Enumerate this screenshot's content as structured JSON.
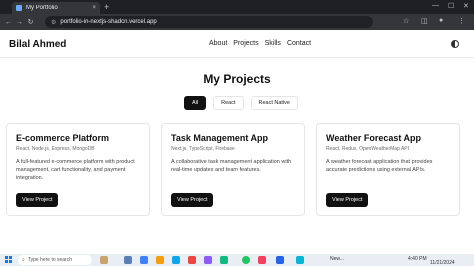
{
  "browser": {
    "tab_title": "My Portfolio",
    "tab_close": "×",
    "new_tab": "+",
    "url": "portfolio-in-nextjs-shadcn.vercel.app",
    "window_controls": [
      "—",
      "☐",
      "✕"
    ]
  },
  "site": {
    "brand": "Bilal Ahmed",
    "nav": [
      "About",
      "Projects",
      "Skills",
      "Contact"
    ]
  },
  "projects": {
    "title": "My Projects",
    "filters": [
      {
        "label": "All",
        "active": true
      },
      {
        "label": "React",
        "active": false
      },
      {
        "label": "React Native",
        "active": false
      }
    ],
    "cards": [
      {
        "title": "E-commerce Platform",
        "tech": "React, Node.js, Express, MongoDB",
        "description": "A full-featured e-commerce platform with product management, cart functionality, and payment integration.",
        "button": "View Project"
      },
      {
        "title": "Task Management App",
        "tech": "Next.js, TypeScript, Firebase",
        "description": "A collaborative task management application with real-time updates and team features.",
        "button": "View Project"
      },
      {
        "title": "Weather Forecast App",
        "tech": "React, Redux, OpenWeatherMap API",
        "description": "A weather forecast application that provides accurate predictions using external APIs.",
        "button": "View Project"
      }
    ]
  },
  "taskbar": {
    "search_placeholder": "Type here to search",
    "weather": "New...",
    "time": "4:40 PM",
    "date": "11/21/2024"
  },
  "colors": {
    "accent": "#111111",
    "chrome_dark": "#35363a",
    "taskbar": "#e9eef5"
  }
}
